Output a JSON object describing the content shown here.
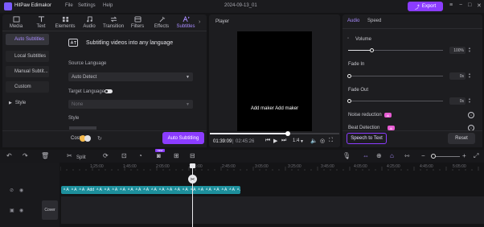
{
  "app": {
    "name": "HitPaw Edimakor",
    "window_title": "2024-09-13_01"
  },
  "menu": [
    "File",
    "Settings",
    "Help"
  ],
  "export_label": "Export",
  "media_tabs": [
    {
      "label": "Media",
      "icon": "media-icon"
    },
    {
      "label": "Text",
      "icon": "text-icon"
    },
    {
      "label": "Elements",
      "icon": "elements-icon"
    },
    {
      "label": "Audio",
      "icon": "audio-icon"
    },
    {
      "label": "Transition",
      "icon": "transition-icon"
    },
    {
      "label": "Filters",
      "icon": "filters-icon"
    },
    {
      "label": "Effects",
      "icon": "effects-icon"
    },
    {
      "label": "Subtitles",
      "icon": "subtitles-icon",
      "active": true
    }
  ],
  "subtitle_nav": [
    {
      "label": "Auto Subtitles",
      "active": true
    },
    {
      "label": "Local Subtitles"
    },
    {
      "label": "Manual Subtit..."
    },
    {
      "label": "Custom"
    },
    {
      "label": "Style",
      "collapsible": true
    }
  ],
  "subtitle_panel": {
    "headline": "Subtitling videos into any language",
    "source_language_label": "Source Language",
    "source_language_value": "Auto Detect",
    "target_language_label": "Target Language",
    "target_language_value": "None",
    "style_label": "Style",
    "cost_label": "Cost:30",
    "auto_button": "Auto Subtitling"
  },
  "player": {
    "label": "Player",
    "overlay_text": "Add maker Add maker",
    "time_current": "01:39:09",
    "time_total": "02:45:26",
    "progress": 0.6,
    "ratio": "1:4"
  },
  "properties": {
    "tabs": [
      {
        "label": "Audio",
        "active": true
      },
      {
        "label": "Speed"
      }
    ],
    "volume_label": "Volume",
    "volume_value": "100%",
    "volume_level": 0.25,
    "fade_in_label": "Fade In",
    "fade_in_value": "0s",
    "fade_out_label": "Fade Out",
    "fade_out_value": "0s",
    "noise_label": "Noise reduction",
    "beat_label": "Beat Detection",
    "ai_badge": "AI",
    "speech_button": "Speech to Text",
    "reset_button": "Reset"
  },
  "timeline": {
    "split_label": "Split",
    "new_badge": "NEW",
    "ticks": [
      "00:00",
      "1:25:00",
      "1:45:00",
      "2:05:00",
      "2:25:00",
      "2:45:00",
      "3:05:00",
      "3:25:00",
      "3:45:00",
      "4:05:00",
      "4:25:00",
      "4:45:00",
      "5:05:00"
    ],
    "subtitle_clip_text": "Add maker Add maker",
    "subtitle_tokens": [
      "A",
      "A",
      "A",
      "Add",
      "A",
      "A",
      "A",
      "A",
      "A",
      "A",
      "A",
      "A",
      "A",
      "A",
      "A",
      "A",
      "A",
      "A",
      "A",
      "A",
      "A",
      "A",
      "A",
      "Add ma"
    ],
    "cover_label": "Cover"
  },
  "colors": {
    "accent": "#8b3cff",
    "active_tab": "#a98cff",
    "subtitle_clip": "#1d8f9c",
    "ai_badge": "#e65bd2"
  }
}
